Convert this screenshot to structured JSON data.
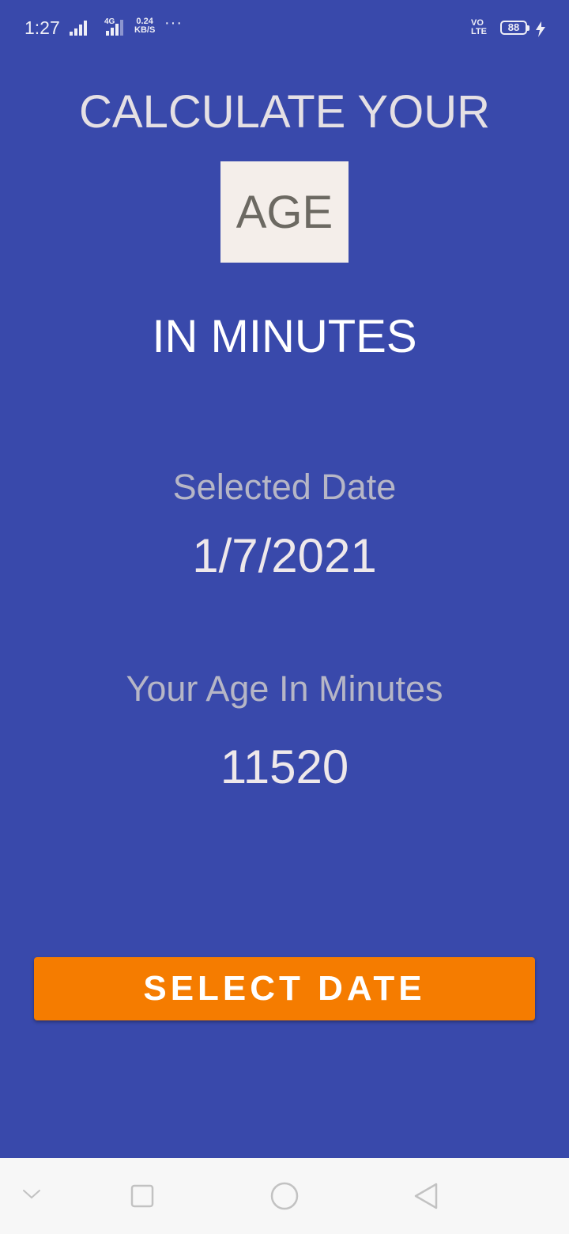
{
  "status_bar": {
    "time": "1:27",
    "network_label": "4G",
    "speed_value": "0.24",
    "speed_unit": "KB/S",
    "more": "···",
    "volte_top": "VO",
    "volte_bottom": "LTE",
    "battery": "88"
  },
  "main": {
    "title_top": "CALCULATE YOUR",
    "title_box": "AGE",
    "title_bottom": "IN MINUTES",
    "selected_date_label": "Selected Date",
    "selected_date_value": "1/7/2021",
    "age_label": "Your Age In Minutes",
    "age_value": "11520",
    "select_button_label": "SELECT DATE"
  },
  "icons": {
    "signal_1": "signal-strength-icon",
    "signal_2": "signal-strength-icon",
    "charging": "lightning-bolt-icon",
    "nav_down": "chevron-down-icon",
    "nav_recent": "square-icon",
    "nav_home": "circle-icon",
    "nav_back": "triangle-back-icon"
  },
  "colors": {
    "background": "#3949AB",
    "button": "#F57C00",
    "age_box": "#F4EEEA",
    "nav_bar": "#F7F7F7"
  }
}
